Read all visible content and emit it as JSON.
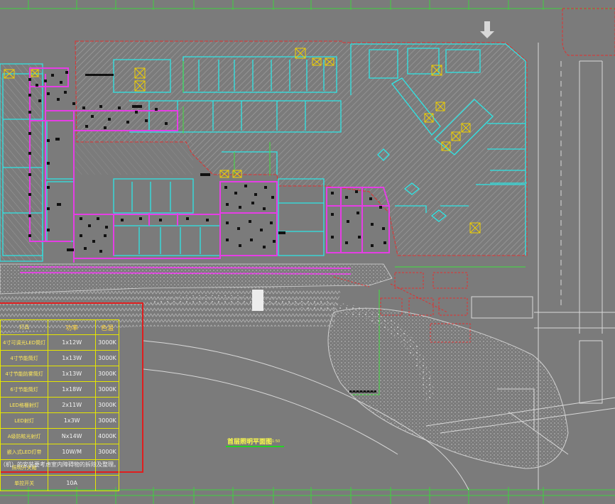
{
  "drawing": {
    "title": "首层照明平面图",
    "scale": "1:50",
    "note": "（机）的安装要考虑室内障碍物的拆除及整理。"
  },
  "legend": {
    "headers": {
      "fixture": "灯具",
      "power": "功率",
      "cct": "色温"
    },
    "rows": [
      {
        "name": "4寸可调光LED筒灯",
        "power": "1x12W",
        "cct": "3000K"
      },
      {
        "name": "4寸节能筒灯",
        "power": "1x13W",
        "cct": "3000K"
      },
      {
        "name": "4寸节能防雾筒灯",
        "power": "1x13W",
        "cct": "3000K"
      },
      {
        "name": "6寸节能筒灯",
        "power": "1x18W",
        "cct": "3000K"
      },
      {
        "name": "LED格栅射灯",
        "power": "2x11W",
        "cct": "3000K"
      },
      {
        "name": "LED射灯",
        "power": "1x3W",
        "cct": "3000K"
      },
      {
        "name": "A级防眩光射灯",
        "power": "Nx14W",
        "cct": "4000K"
      },
      {
        "name": "嵌入式LED灯带",
        "power": "10W/M",
        "cct": "3000K"
      },
      {
        "name": "照明开关箱",
        "power": "",
        "cct": ""
      },
      {
        "name": "单控开关",
        "power": "10A",
        "cct": ""
      }
    ]
  },
  "colors": {
    "background": "#7b7b7b",
    "grid": "#3fd03f",
    "walls": "#2ee6e6",
    "lighting_circuit": "#e53ee5",
    "boundary": "#e01e1e",
    "legend_border": "#e6e600",
    "equipment": "#f0d000",
    "hatch": "#a4a4a4"
  }
}
